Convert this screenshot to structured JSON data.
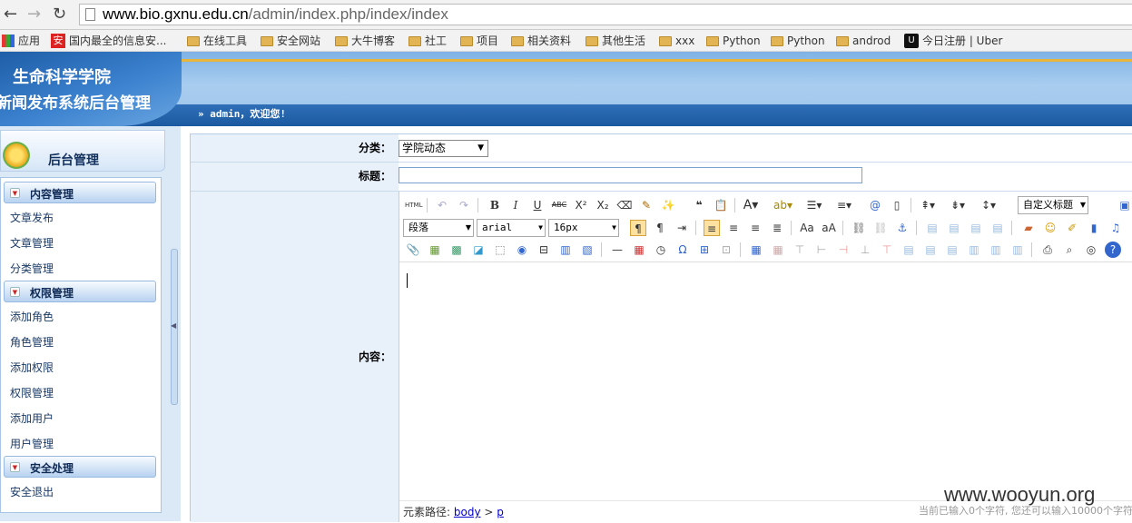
{
  "browser": {
    "url_host": "www.bio.gxnu.edu.cn",
    "url_path": "/admin/index.php/index/index",
    "bookmarks": [
      "应用",
      "国内最全的信息安...",
      "在线工具",
      "安全网站",
      "大牛博客",
      "社工",
      "项目",
      "相关资料",
      "其他生活",
      "xxx",
      "Python",
      "Python",
      "androd",
      "今日注册 | Uber"
    ]
  },
  "header": {
    "school_name": "生命科学学院",
    "system_name": "新闻发布系统后台管理",
    "welcome": "admin，欢迎您!"
  },
  "sidebar": {
    "title": "后台管理",
    "groups": [
      {
        "label": "内容管理",
        "items": [
          "文章发布",
          "文章管理",
          "分类管理"
        ]
      },
      {
        "label": "权限管理",
        "items": [
          "添加角色",
          "角色管理",
          "添加权限",
          "权限管理",
          "添加用户",
          "用户管理"
        ]
      },
      {
        "label": "安全处理",
        "items": [
          "安全退出"
        ]
      }
    ]
  },
  "form": {
    "category_label": "分类：",
    "category_value": "学院动态",
    "title_label": "标题：",
    "title_value": "",
    "content_label": "内容："
  },
  "editor": {
    "paragraph_value": "段落",
    "font_value": "arial",
    "size_value": "16px",
    "custom_title": "自定义标题",
    "path_label": "元素路径:",
    "path_body": "body",
    "path_p": "p",
    "path_sep": ">",
    "counter": "当前已输入0个字符, 您还可以输入10000个字符"
  },
  "watermark": "www.wooyun.org"
}
